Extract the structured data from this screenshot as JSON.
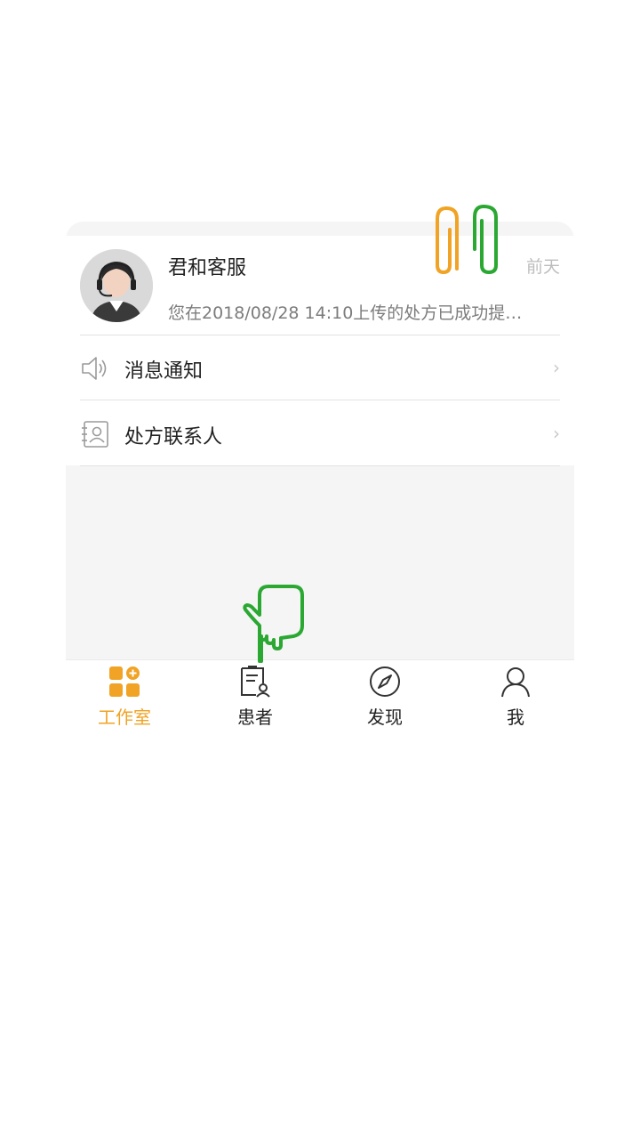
{
  "chat": {
    "name": "君和客服",
    "time": "前天",
    "preview": "您在2018/08/28 14:10上传的处方已成功提…"
  },
  "menu": {
    "notice_label": "消息通知",
    "contact_label": "处方联系人",
    "chevron": "›"
  },
  "tabs": [
    {
      "label": "工作室",
      "icon": "workspace-icon",
      "active": true
    },
    {
      "label": "患者",
      "icon": "patient-icon",
      "active": false
    },
    {
      "label": "发现",
      "icon": "compass-icon",
      "active": false
    },
    {
      "label": "我",
      "icon": "user-icon",
      "active": false
    }
  ],
  "colors": {
    "accent": "#f0a325",
    "overlay_orange": "#f0a325",
    "overlay_green": "#2aa832"
  },
  "overlays": [
    "paperclip-icon",
    "pointing-hand-icon"
  ]
}
